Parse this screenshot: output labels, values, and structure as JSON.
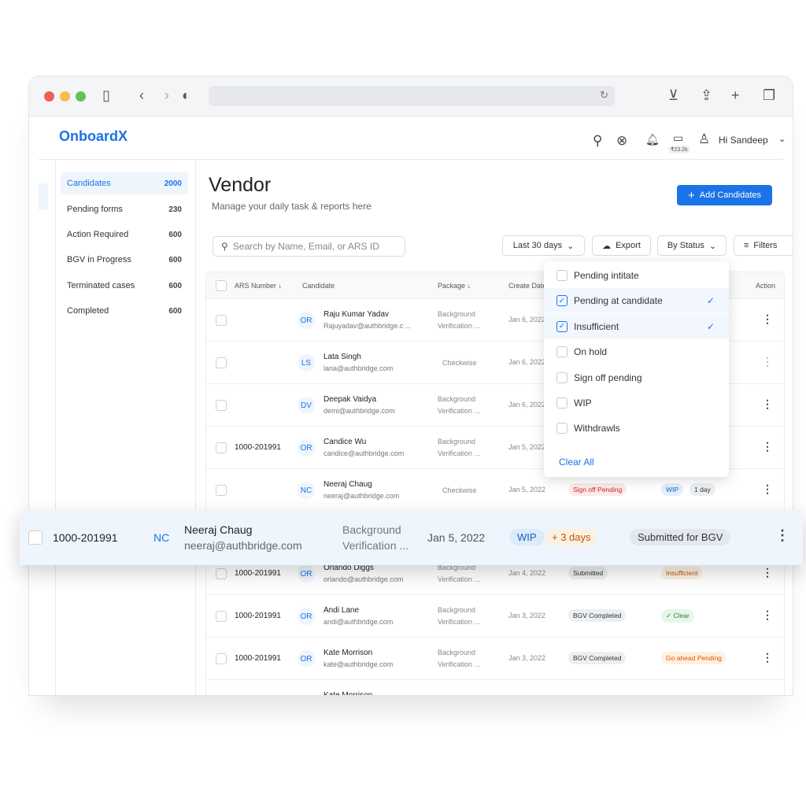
{
  "app": {
    "logo": "OnboardX",
    "greeting": "Hi Sandeep",
    "wallet_balance": "₹23.2k"
  },
  "browser": {
    "icons": [
      "sidebar-icon",
      "back-icon",
      "forward-icon",
      "shield-icon",
      "reload-icon",
      "download-icon",
      "share-icon",
      "new-tab-icon",
      "tabs-icon"
    ]
  },
  "sidebar": {
    "items": [
      {
        "label": "Candidates",
        "count": "2000"
      },
      {
        "label": "Pending forms",
        "count": "230"
      },
      {
        "label": "Action Required",
        "count": "600"
      },
      {
        "label": "BGV in Progress",
        "count": "600"
      },
      {
        "label": "Terminated cases",
        "count": "600"
      },
      {
        "label": "Completed",
        "count": "600"
      }
    ]
  },
  "page": {
    "title": "Vendor",
    "subtitle": "Manage your daily task & reports here",
    "add_button": "Add Candidates"
  },
  "toolbar": {
    "search_placeholder": "Search by Name, Email, or ARS ID",
    "date_range": "Last 30 days",
    "export": "Export",
    "status": "By Status",
    "filters": "Filters"
  },
  "table": {
    "headers": {
      "ars": "ARS Number",
      "candidate": "Candidate",
      "package": "Package",
      "date": "Create Date",
      "action": "Action"
    },
    "rows": [
      {
        "ars": "",
        "initials": "OR",
        "name": "Raju Kumar Yadav",
        "email": "Rajuyadav@authbridge.c ...",
        "package": [
          "Background",
          "Verification ..."
        ],
        "date": "Jan 6, 2022"
      },
      {
        "ars": "",
        "initials": "LS",
        "name": "Lata Singh",
        "email": "lana@authbridge.com",
        "package": [
          "Checkwise",
          ""
        ],
        "date": "Jan 6, 2022"
      },
      {
        "ars": "",
        "initials": "DV",
        "name": "Deepak Vaidya",
        "email": "demi@authbridge.com",
        "package": [
          "Background",
          "Verification ..."
        ],
        "date": "Jan 6, 2022"
      },
      {
        "ars": "1000-201991",
        "initials": "OR",
        "name": "Candice Wu",
        "email": "candice@authbridge.com",
        "package": [
          "Background",
          "Verification ..."
        ],
        "date": "Jan 5, 2022"
      },
      {
        "ars": "",
        "initials": "NC",
        "name": "Neeraj Chaug",
        "email": "neeraj@authbridge.com",
        "package": [
          "Checkwise",
          ""
        ],
        "date": "Jan 5, 2022",
        "status": "Sign off Pending",
        "sub": "WIP",
        "days": "1 day"
      },
      {
        "ars": "1000-201991",
        "initials": "OR",
        "name": "Orlando Diggs",
        "email": "orlando@authbridge.com",
        "package": [
          "Background",
          "Verification ..."
        ],
        "date": "Jan 4, 2022",
        "status": "Submitted",
        "sub": "Insufficient"
      },
      {
        "ars": "1000-201991",
        "initials": "OR",
        "name": "Andi Lane",
        "email": "andi@authbridge.com",
        "package": [
          "Background",
          "Verification ..."
        ],
        "date": "Jan 3, 2022",
        "status": "BGV Completed",
        "sub": "✓ Clear"
      },
      {
        "ars": "1000-201991",
        "initials": "OR",
        "name": "Kate Morrison",
        "email": "kate@authbridge.com",
        "package": [
          "Background",
          "Verification ..."
        ],
        "date": "Jan 3, 2022",
        "status": "BGV Completed",
        "sub": "Go ahead Pending"
      },
      {
        "ars": "",
        "initials": "",
        "name": "Kate Morrison",
        "email": "",
        "package": [
          "Background",
          ""
        ],
        "date": ""
      }
    ]
  },
  "status_dropdown": {
    "options": [
      {
        "label": "Pending intitate",
        "checked": false
      },
      {
        "label": "Pending at candidate",
        "checked": true
      },
      {
        "label": "Insufficient",
        "checked": true
      },
      {
        "label": "On hold",
        "checked": false
      },
      {
        "label": "Sign off pending",
        "checked": false
      },
      {
        "label": "WIP",
        "checked": false
      },
      {
        "label": "Withdrawls",
        "checked": false
      }
    ],
    "clear_all": "Clear All"
  },
  "highlighted_row": {
    "ars": "1000-201991",
    "initials": "NC",
    "name": "Neeraj Chaug",
    "email": "neeraj@authbridge.com",
    "package": [
      "Background",
      "Verification ..."
    ],
    "date": "Jan 5, 2022",
    "status": "WIP",
    "days": "+ 3 days",
    "sub": "Submitted for BGV"
  },
  "colors": {
    "accent": "#1a73e8",
    "danger": "#c62828",
    "warning": "#e65100",
    "success": "#2e7d32"
  }
}
